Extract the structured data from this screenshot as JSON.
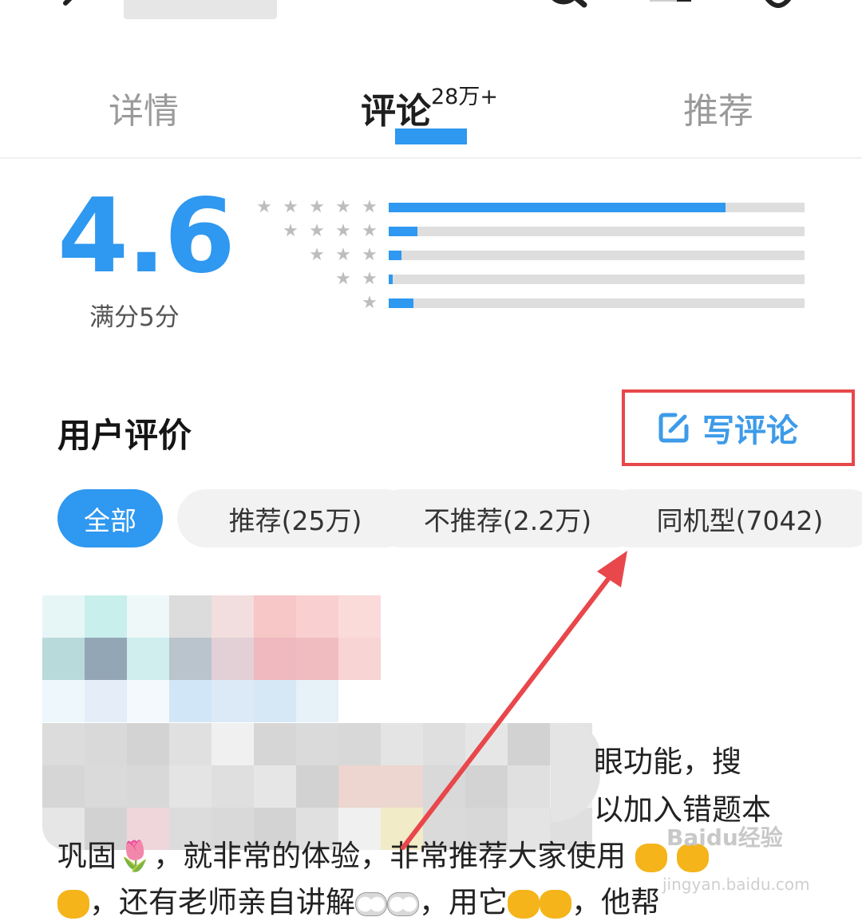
{
  "header": {
    "back_icon": "arrow-left-icon",
    "search_icon": "search-icon",
    "menu_icon": "menu-icon",
    "download_icon": "download-icon"
  },
  "tabs": [
    {
      "label": "详情",
      "active": false
    },
    {
      "label": "评论",
      "badge": "28万+",
      "active": true
    },
    {
      "label": "推荐",
      "active": false
    }
  ],
  "rating": {
    "score": "4.6",
    "max_label": "满分5分",
    "distribution": [
      {
        "stars": 5,
        "fraction": 0.81
      },
      {
        "stars": 4,
        "fraction": 0.07
      },
      {
        "stars": 3,
        "fraction": 0.03
      },
      {
        "stars": 2,
        "fraction": 0.01
      },
      {
        "stars": 1,
        "fraction": 0.06
      }
    ]
  },
  "reviews_section": {
    "title": "用户评价",
    "write_review_label": "写评论",
    "write_review_icon": "edit-icon"
  },
  "filters": [
    {
      "label": "全部",
      "active": true
    },
    {
      "label": "推荐(25万)",
      "active": false
    },
    {
      "label": "不推荐(2.2万)",
      "active": false
    },
    {
      "label": "同机型(7042)",
      "active": false
    }
  ],
  "review": {
    "line1_tail": "眼功能，搜",
    "line2_tail": "以加入错题本",
    "line3": "巩固🌷，就非常的体验，非常推荐大家使用",
    "line4": "，还有老师亲自讲解",
    "line4_mid": "，用它",
    "line4_end": "，他帮"
  },
  "watermark": {
    "text": "Baidu经验",
    "sub": "jingyan.baidu.com"
  },
  "colors": {
    "accent": "#2f98f0",
    "highlight_box": "#e8474b",
    "arrow": "#e8474b"
  }
}
